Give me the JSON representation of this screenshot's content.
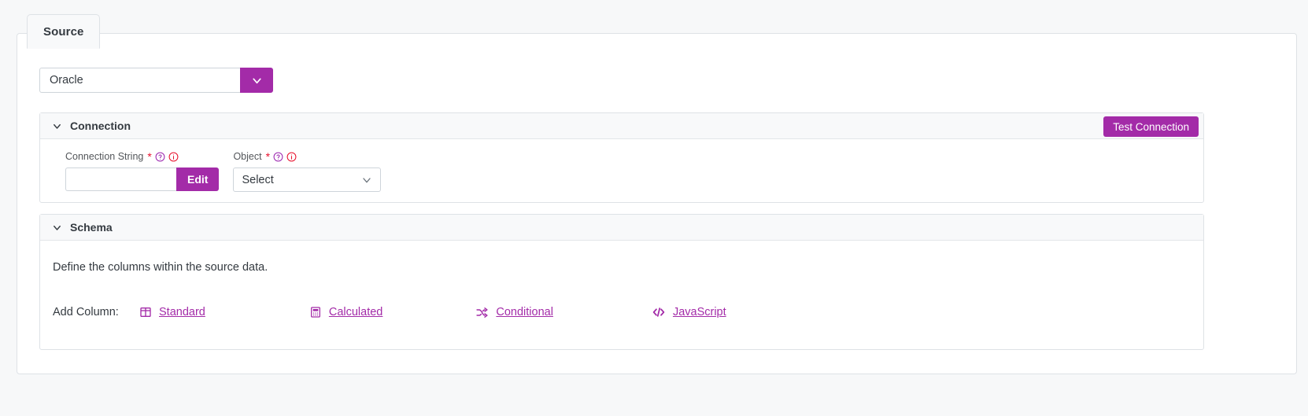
{
  "tab": {
    "label": "Source"
  },
  "source_type": {
    "value": "Oracle",
    "caret_icon": "chevron-down-icon",
    "accent": "#a32ba8"
  },
  "connection": {
    "title": "Connection",
    "collapse_icon": "chevron-down-icon",
    "test_button": "Test Connection",
    "fields": {
      "connection_string": {
        "label": "Connection String",
        "required_marker": "*",
        "help_icon": "question-circle-icon",
        "info_icon": "info-circle-icon",
        "value": "",
        "placeholder": "",
        "edit_button": "Edit"
      },
      "object": {
        "label": "Object",
        "required_marker": "*",
        "help_icon": "question-circle-icon",
        "info_icon": "info-circle-icon",
        "value": "Select",
        "caret_icon": "chevron-down-icon"
      }
    }
  },
  "schema": {
    "title": "Schema",
    "collapse_icon": "chevron-down-icon",
    "description": "Define the columns within the source data.",
    "add_column_label": "Add Column:",
    "add_column_options": [
      {
        "label": "Standard",
        "icon": "columns-icon"
      },
      {
        "label": "Calculated",
        "icon": "calculator-icon"
      },
      {
        "label": "Conditional",
        "icon": "shuffle-icon"
      },
      {
        "label": "JavaScript",
        "icon": "code-icon"
      }
    ]
  },
  "colors": {
    "accent": "#a32ba8",
    "required_red": "#e8112d",
    "info_red": "#e8112d",
    "page_bg": "#f7f8f9",
    "border": "#dee2e6"
  }
}
